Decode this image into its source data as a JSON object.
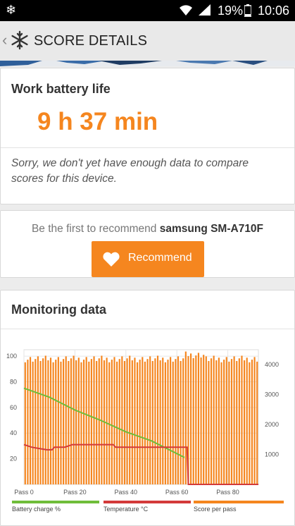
{
  "status_bar": {
    "notification_icon": "snowflake-icon",
    "battery_percent": "19%",
    "time": "10:06"
  },
  "app_bar": {
    "title": "SCORE DETAILS",
    "back_icon": "chevron-left-icon",
    "logo_icon": "snowflake-logo-icon"
  },
  "battery_card": {
    "label": "Work battery life",
    "value": "9 h 37 min",
    "note": "Sorry, we don't yet have enough data to compare scores for this device."
  },
  "recommend_card": {
    "prompt_prefix": "Be the first to recommend",
    "device": "samsung SM-A710F",
    "button_label": "Recommend"
  },
  "monitoring_card": {
    "label": "Monitoring data"
  },
  "chart_data": {
    "type": "line",
    "x_tick_labels": [
      "Pass 0",
      "Pass 20",
      "Pass 40",
      "Pass 60",
      "Pass 80"
    ],
    "x_range": [
      0,
      92
    ],
    "left_axis_ticks": [
      20,
      40,
      60,
      80,
      100
    ],
    "left_axis_range": [
      0,
      105
    ],
    "right_axis_ticks": [
      1000,
      2000,
      3000,
      4000
    ],
    "right_axis_range": [
      0,
      4500
    ],
    "grid": true,
    "legend_placement": "bottom",
    "series": [
      {
        "name": "Battery charge %",
        "color": "#6fbd3a",
        "axis": "left",
        "points": [
          [
            0,
            75
          ],
          [
            10,
            68
          ],
          [
            20,
            58
          ],
          [
            30,
            50
          ],
          [
            40,
            41
          ],
          [
            50,
            34
          ],
          [
            60,
            24
          ],
          [
            63,
            21
          ]
        ]
      },
      {
        "name": "Temperature °C",
        "color": "#d33a3a",
        "axis": "left",
        "points": [
          [
            0,
            31
          ],
          [
            3,
            29
          ],
          [
            6,
            28
          ],
          [
            9,
            27
          ],
          [
            11,
            27
          ],
          [
            12,
            29
          ],
          [
            16,
            29
          ],
          [
            19,
            31
          ],
          [
            35,
            31
          ],
          [
            36,
            29
          ],
          [
            55,
            29
          ],
          [
            64,
            29
          ],
          [
            64.5,
            0
          ],
          [
            92,
            0
          ]
        ]
      },
      {
        "name": "Score per pass",
        "color": "#f5861f",
        "axis": "right",
        "value_range": [
          4080,
          4480
        ],
        "pass_count": 92
      }
    ]
  }
}
